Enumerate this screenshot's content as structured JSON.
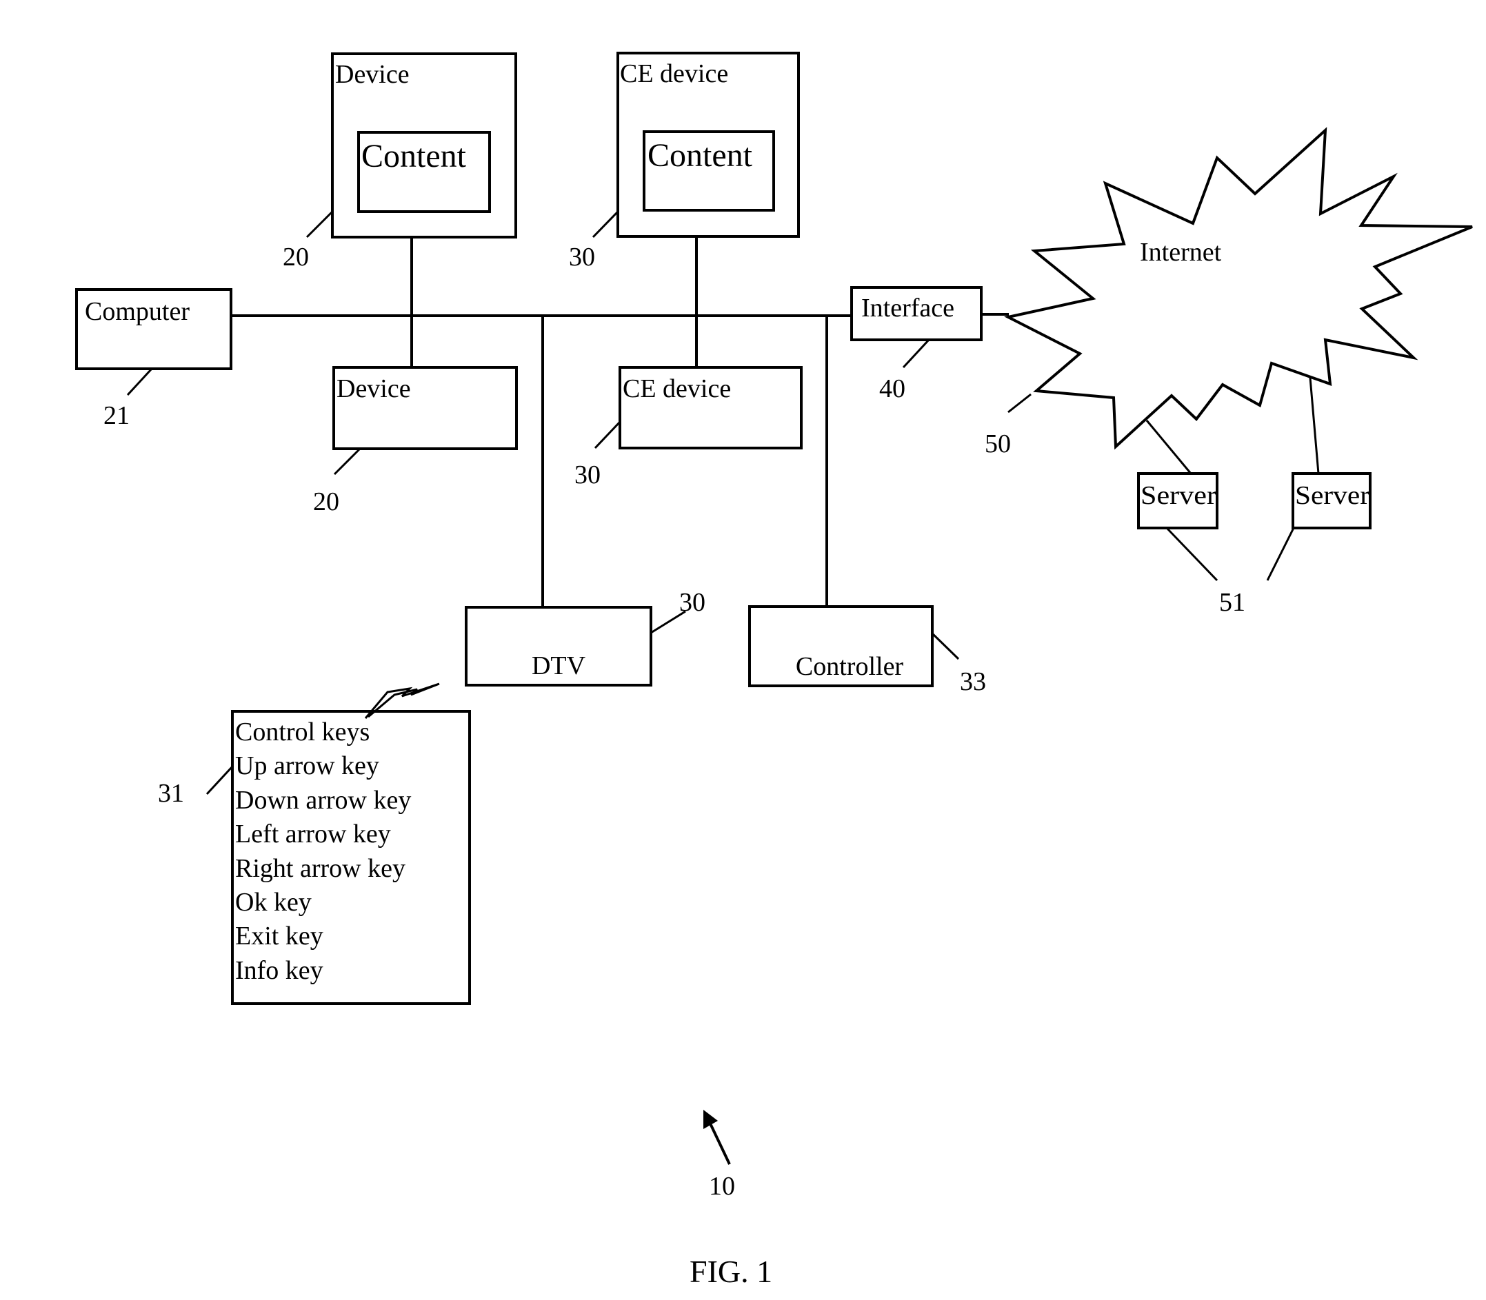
{
  "figure": {
    "caption": "FIG. 1",
    "system_ref": "10"
  },
  "nodes": {
    "device_top": {
      "label": "Device",
      "content_label": "Content",
      "ref": "20"
    },
    "ce_device_top": {
      "label": "CE device",
      "content_label": "Content",
      "ref": "30"
    },
    "computer": {
      "label": "Computer",
      "ref": "21"
    },
    "device_bottom": {
      "label": "Device",
      "ref": "20"
    },
    "ce_device_bottom": {
      "label": "CE device",
      "ref": "30"
    },
    "interface": {
      "label": "Interface",
      "ref": "40"
    },
    "internet": {
      "label": "Internet",
      "ref": "50"
    },
    "server_1": {
      "label": "Server"
    },
    "server_2": {
      "label": "Server"
    },
    "servers_ref": "51",
    "dtv": {
      "label": "DTV",
      "ref": "30"
    },
    "controller": {
      "label": "Controller",
      "ref": "33"
    },
    "remote": {
      "ref": "31",
      "keys": [
        "Control keys",
        "Up arrow key",
        "Down arrow key",
        "Left arrow key",
        "Right arrow key",
        "Ok key",
        "Exit key",
        "Info key"
      ]
    }
  }
}
